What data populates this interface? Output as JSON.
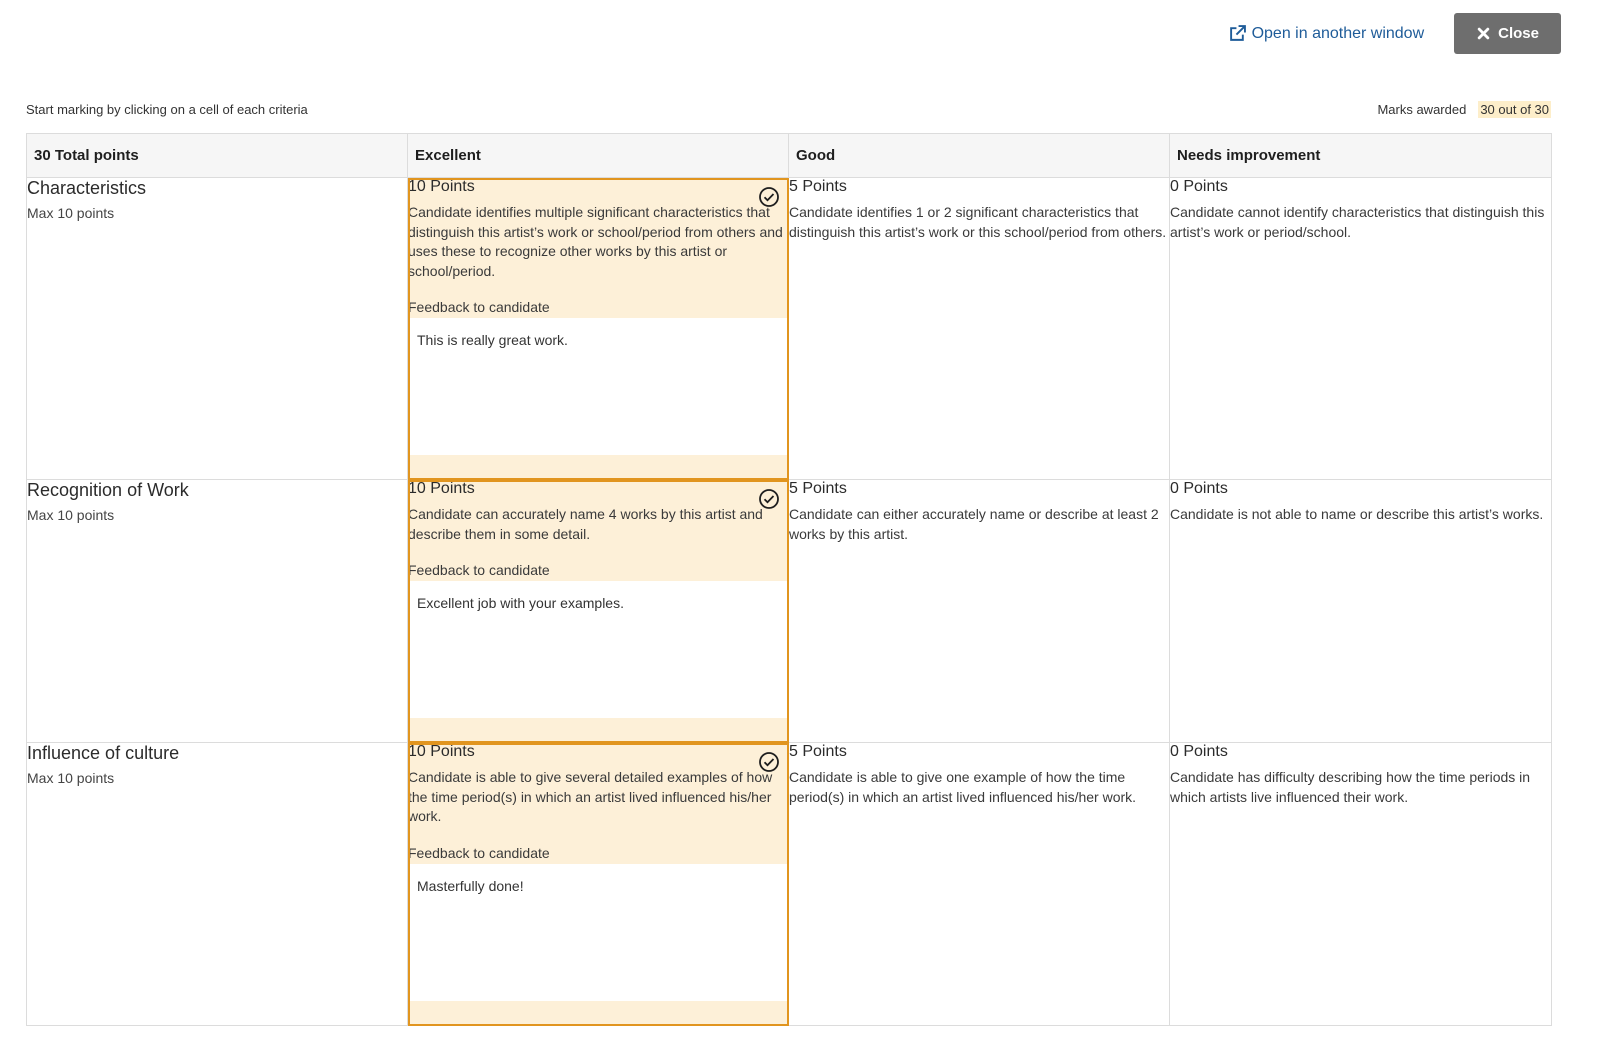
{
  "header": {
    "open_window_label": "Open in another window",
    "close_label": "Close"
  },
  "instructions": "Start marking by clicking on a cell of each criteria",
  "marks": {
    "label": "Marks awarded",
    "value": "30 out of 30"
  },
  "table": {
    "total_header": "30 Total points",
    "levels": [
      "Excellent",
      "Good",
      "Needs improvement"
    ],
    "criteria": [
      {
        "name": "Characteristics",
        "max": "Max 10 points",
        "cells": [
          {
            "points": "10 Points",
            "desc": "Candidate identifies multiple significant characteristics that distinguish this artist’s work or school/period from others and uses these to recognize other works by this artist or school/period.",
            "selected": true
          },
          {
            "points": "5 Points",
            "desc": "Candidate identifies 1 or 2 significant characteristics that distinguish this artist’s work or this school/period from others."
          },
          {
            "points": "0 Points",
            "desc": "Candidate cannot identify characteristics that distinguish this artist’s work or period/school."
          }
        ],
        "feedback_label": "Feedback to candidate",
        "feedback": "This is really great work."
      },
      {
        "name": "Recognition of Work",
        "max": "Max 10 points",
        "cells": [
          {
            "points": "10 Points",
            "desc": "Candidate can accurately name 4 works by this artist and describe them in some detail.",
            "selected": true
          },
          {
            "points": "5 Points",
            "desc": "Candidate can either accurately name or describe at least 2 works by this artist."
          },
          {
            "points": "0 Points",
            "desc": "Candidate is not able to name or describe this artist’s works."
          }
        ],
        "feedback_label": "Feedback to candidate",
        "feedback": "Excellent job with your examples."
      },
      {
        "name": "Influence of culture",
        "max": "Max 10 points",
        "cells": [
          {
            "points": "10 Points",
            "desc": "Candidate is able to give several detailed examples of how the time period(s) in which an artist lived influenced his/her work.",
            "selected": true
          },
          {
            "points": "5 Points",
            "desc": "Candidate is able to give one example of how the time period(s) in which an artist lived influenced his/her work."
          },
          {
            "points": "0 Points",
            "desc": "Candidate has difficulty describing how the time periods in which artists live influenced their work."
          }
        ],
        "feedback_label": "Feedback to candidate",
        "feedback": "Masterfully done!"
      }
    ]
  },
  "colors": {
    "selected_bg": "#fdf0d8",
    "selected_border": "#e1951f",
    "link": "#1f5c99",
    "close_bg": "#6e6e6e"
  }
}
